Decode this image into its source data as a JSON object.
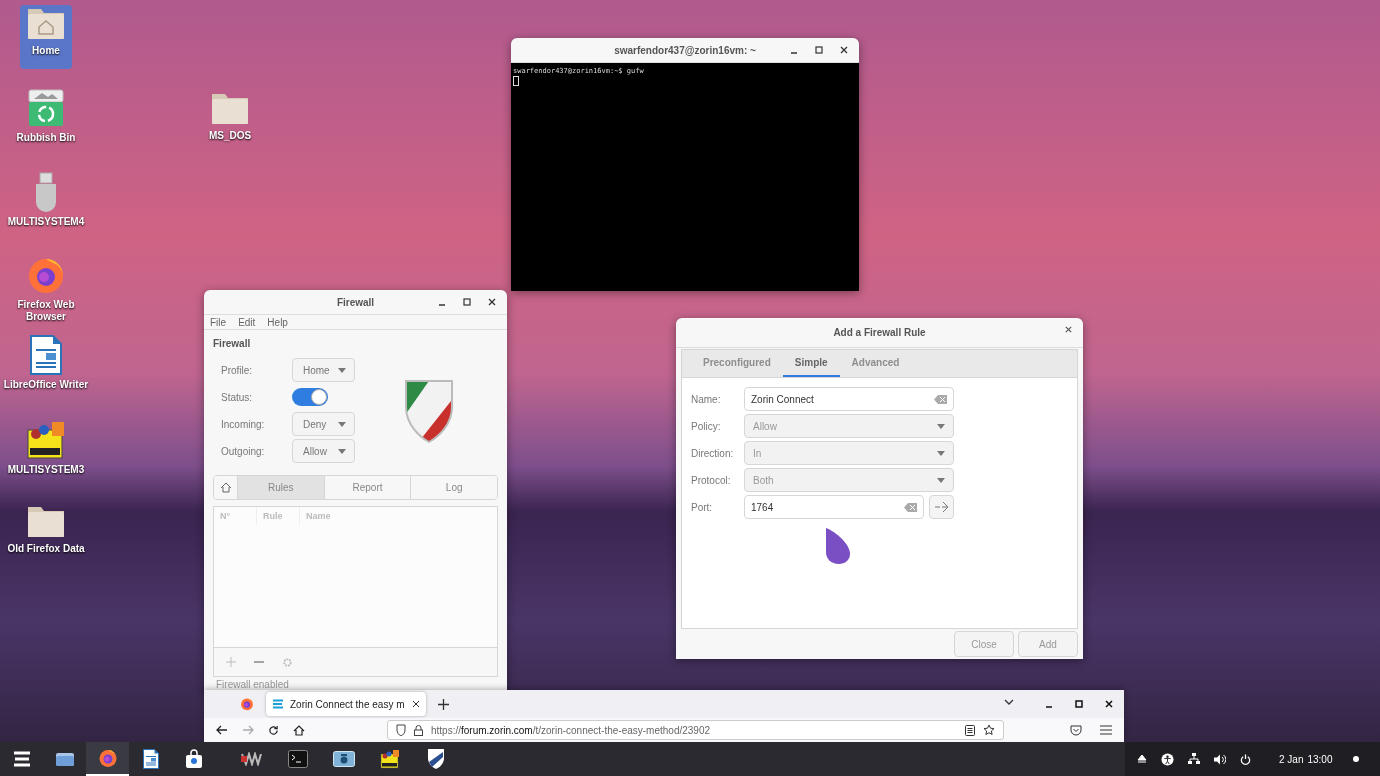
{
  "desktop_icons": [
    {
      "label": "Home",
      "kind": "home",
      "selected": true
    },
    {
      "label": "Rubbish Bin",
      "kind": "trash",
      "selected": false
    },
    {
      "label": "MS_DOS",
      "kind": "folder",
      "selected": false
    },
    {
      "label": "MULTISYSTEM4",
      "kind": "usb",
      "selected": false
    },
    {
      "label": "Firefox Web Browser",
      "kind": "firefox",
      "selected": false
    },
    {
      "label": "LibreOffice Writer",
      "kind": "writer",
      "selected": false
    },
    {
      "label": "MULTISYSTEM3",
      "kind": "multisystem",
      "selected": false
    },
    {
      "label": "Old Firefox Data",
      "kind": "folder",
      "selected": false
    }
  ],
  "terminal": {
    "title": "swarfendor437@zorin16vm: ~",
    "lines": [
      "swarfendor437@zorin16vm:~$ gufw"
    ]
  },
  "firewall": {
    "title": "Firewall",
    "menu": [
      "File",
      "Edit",
      "Help"
    ],
    "section": "Firewall",
    "fields": [
      {
        "kind": "dropdown",
        "label": "Profile:",
        "value": "Home"
      },
      {
        "kind": "switch",
        "label": "Status:",
        "on": true
      },
      {
        "kind": "dropdown",
        "label": "Incoming:",
        "value": "Deny"
      },
      {
        "kind": "dropdown",
        "label": "Outgoing:",
        "value": "Allow"
      }
    ],
    "tabs": [
      {
        "kind": "home",
        "selected": false
      },
      {
        "kind": "text",
        "label": "Rules",
        "selected": true
      },
      {
        "kind": "text",
        "label": "Report",
        "selected": false
      },
      {
        "kind": "text",
        "label": "Log",
        "selected": false
      }
    ],
    "columns": [
      "N°",
      "Rule",
      "Name"
    ],
    "status": "Firewall enabled"
  },
  "dialog": {
    "title": "Add a Firewall Rule",
    "tabs": [
      {
        "label": "Preconfigured",
        "selected": false
      },
      {
        "label": "Simple",
        "selected": true
      },
      {
        "label": "Advanced",
        "selected": false
      }
    ],
    "fields": [
      {
        "kind": "entry",
        "label": "Name:",
        "value": "Zorin Connect"
      },
      {
        "kind": "dropdown",
        "label": "Policy:",
        "value": "Allow"
      },
      {
        "kind": "dropdown",
        "label": "Direction:",
        "value": "In"
      },
      {
        "kind": "dropdown",
        "label": "Protocol:",
        "value": "Both"
      },
      {
        "kind": "entry_button",
        "label": "Port:",
        "value": "1764"
      }
    ],
    "buttons": [
      "Close",
      "Add"
    ]
  },
  "browser": {
    "tabs": [
      {
        "kind": "pinned",
        "selected": false
      },
      {
        "kind": "page",
        "title": "Zorin Connect the easy m",
        "selected": true
      }
    ],
    "url": "https://**forum.zorin.com**/t/zorin-connect-the-easy-method/23902"
  },
  "taskbar": {
    "items": [
      {
        "kind": "zorin",
        "selected": false
      },
      {
        "kind": "files",
        "selected": false
      },
      {
        "kind": "firefox",
        "selected": true
      },
      {
        "kind": "writer",
        "selected": false
      },
      {
        "kind": "store",
        "selected": false
      },
      {
        "kind": "vm",
        "selected": false
      },
      {
        "kind": "terminal",
        "selected": false
      },
      {
        "kind": "screenshot",
        "selected": false
      },
      {
        "kind": "multisystem",
        "selected": false
      },
      {
        "kind": "shield",
        "selected": false
      }
    ],
    "date": "2 Jan",
    "time": "13:00"
  }
}
